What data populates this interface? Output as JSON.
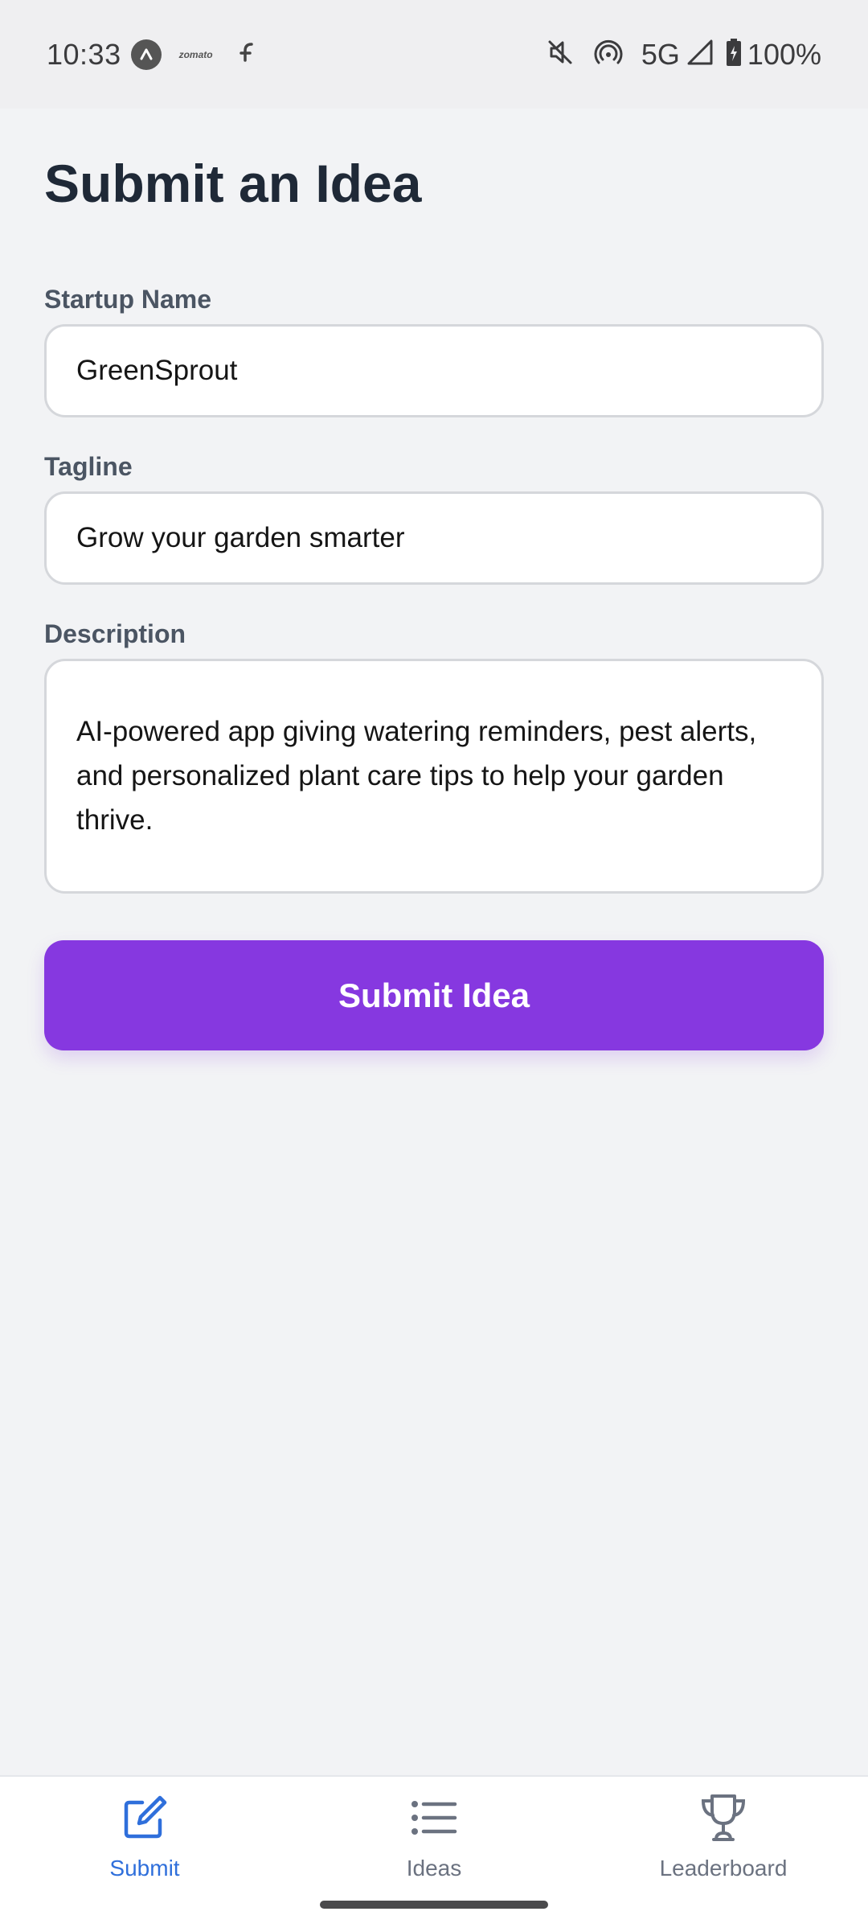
{
  "status_bar": {
    "time": "10:33",
    "app_label": "zomato",
    "network": "5G",
    "battery": "100%"
  },
  "page": {
    "title": "Submit an Idea"
  },
  "form": {
    "startup_name_label": "Startup Name",
    "startup_name_value": "GreenSprout",
    "tagline_label": "Tagline",
    "tagline_value": "Grow your garden smarter",
    "description_label": "Description",
    "description_value": "AI-powered app giving watering reminders, pest alerts, and personalized plant care tips to help your garden thrive.",
    "submit_label": "Submit Idea"
  },
  "nav": {
    "items": [
      {
        "label": "Submit",
        "icon": "edit-icon",
        "active": true
      },
      {
        "label": "Ideas",
        "icon": "list-icon",
        "active": false
      },
      {
        "label": "Leaderboard",
        "icon": "trophy-icon",
        "active": false
      }
    ]
  },
  "colors": {
    "accent": "#8638e0",
    "active_nav": "#2f6fdb",
    "background": "#f2f3f5"
  }
}
